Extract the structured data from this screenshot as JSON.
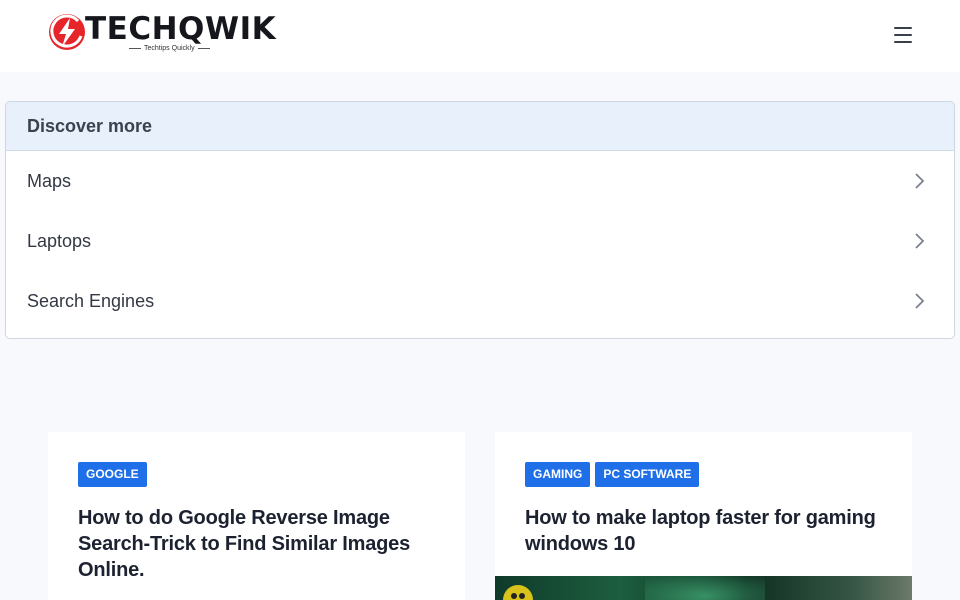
{
  "header": {
    "logo_text": "TECHQWIK",
    "logo_tagline": "Techtips Quickly"
  },
  "discover": {
    "title": "Discover more",
    "items": [
      {
        "label": "Maps"
      },
      {
        "label": "Laptops"
      },
      {
        "label": "Search Engines"
      }
    ]
  },
  "posts": [
    {
      "tags": [
        "GOOGLE"
      ],
      "title": "How to do Google Reverse Image Search-Trick to Find Similar Images Online."
    },
    {
      "tags": [
        "GAMING",
        "PC SOFTWARE"
      ],
      "title": "How to make laptop faster for gaming windows 10"
    }
  ],
  "colors": {
    "accent": "#1e6fe8",
    "logo_red": "#e5252a",
    "discover_header_bg": "#e8f0fc"
  }
}
